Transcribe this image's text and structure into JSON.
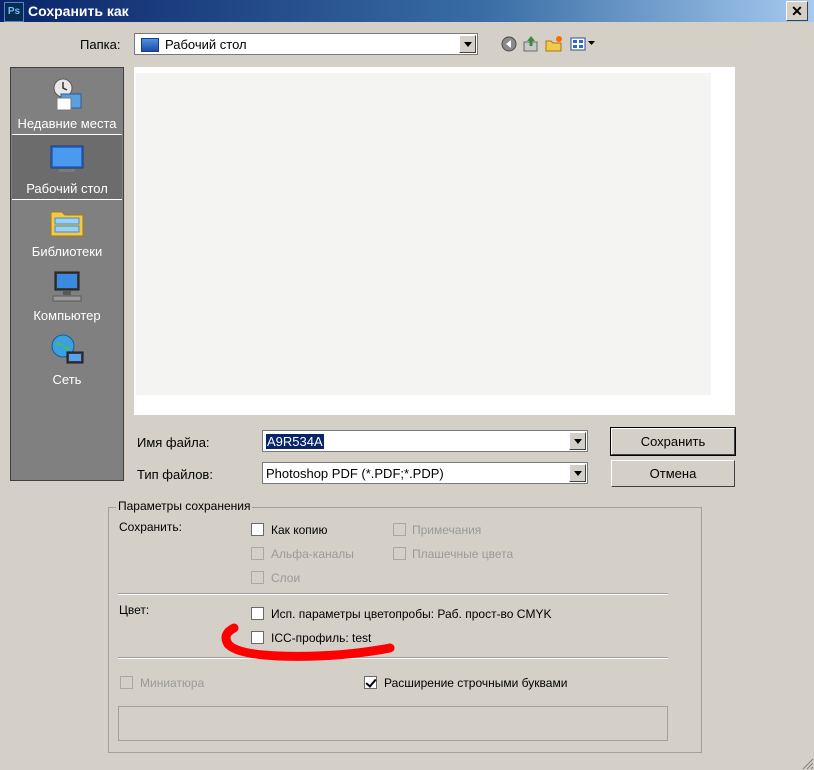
{
  "window": {
    "title": "Сохранить как",
    "app_badge": "Ps",
    "close_glyph": "✕"
  },
  "folder": {
    "label": "Папка:",
    "value": "Рабочий стол"
  },
  "toolbar": {
    "icons": [
      "back-icon",
      "up-folder-icon",
      "new-folder-icon",
      "view-menu-icon"
    ]
  },
  "places": [
    {
      "label": "Недавние места",
      "icon": "recent-places-icon",
      "selected": false
    },
    {
      "label": "Рабочий стол",
      "icon": "desktop-icon",
      "selected": true
    },
    {
      "label": "Библиотеки",
      "icon": "libraries-icon",
      "selected": false
    },
    {
      "label": "Компьютер",
      "icon": "computer-icon",
      "selected": false
    },
    {
      "label": "Сеть",
      "icon": "network-icon",
      "selected": false
    }
  ],
  "filename": {
    "label": "Имя файла:",
    "value": "A9R534A"
  },
  "filetype": {
    "label": "Тип файлов:",
    "value": "Photoshop PDF (*.PDF;*.PDP)"
  },
  "buttons": {
    "save": "Сохранить",
    "cancel": "Отмена"
  },
  "options": {
    "title": "Параметры сохранения",
    "save_label": "Сохранить:",
    "as_copy": {
      "label": "Как копию",
      "checked": false,
      "enabled": true
    },
    "notes": {
      "label": "Примечания",
      "checked": false,
      "enabled": false
    },
    "alpha": {
      "label": "Альфа-каналы",
      "checked": false,
      "enabled": false
    },
    "spot": {
      "label": "Плашечные цвета",
      "checked": false,
      "enabled": false
    },
    "layers": {
      "label": "Слои",
      "checked": false,
      "enabled": false
    },
    "color_label": "Цвет:",
    "proof": {
      "label": "Исп. параметры цветопробы:  Раб. прост-во CMYK",
      "checked": false,
      "enabled": true
    },
    "icc": {
      "label": "ICC-профиль:  test",
      "checked": false,
      "enabled": true
    },
    "thumbnail": {
      "label": "Миниатюра",
      "checked": false,
      "enabled": false
    },
    "lowercase": {
      "label": "Расширение строчными буквами",
      "checked": true,
      "enabled": true
    }
  },
  "colors": {
    "annotation": "#ff0000",
    "titlebar": "#0a246a",
    "selection": "#0a246a"
  }
}
